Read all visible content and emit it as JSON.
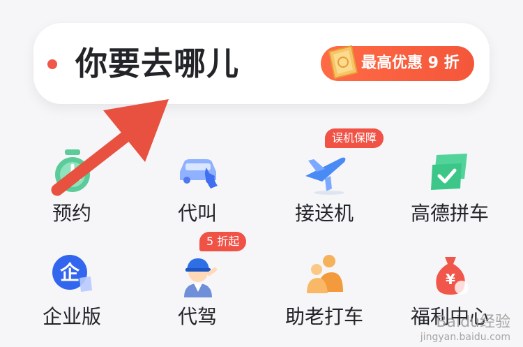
{
  "search": {
    "placeholder": "你要去哪儿",
    "promo_label": "最高优惠 9 折"
  },
  "services": [
    {
      "label": "预约",
      "icon": "alarm-clock-icon"
    },
    {
      "label": "代叫",
      "icon": "car-phone-icon"
    },
    {
      "label": "接送机",
      "icon": "airplane-icon",
      "badge": "误机保障"
    },
    {
      "label": "高德拼车",
      "icon": "carpool-tickets-icon"
    },
    {
      "label": "企业版",
      "icon": "enterprise-icon"
    },
    {
      "label": "代驾",
      "icon": "driver-icon",
      "badge": "5 折起"
    },
    {
      "label": "助老打车",
      "icon": "elderly-people-icon"
    },
    {
      "label": "福利中心",
      "icon": "money-bag-icon"
    }
  ],
  "watermark": {
    "text": "Baidu经验",
    "url": "jingyan.baidu.com"
  },
  "colors": {
    "accent_red": "#f05246",
    "promo_orange": "#ff6b45",
    "text_dark": "#222428",
    "arrow_red": "#e8503f"
  }
}
